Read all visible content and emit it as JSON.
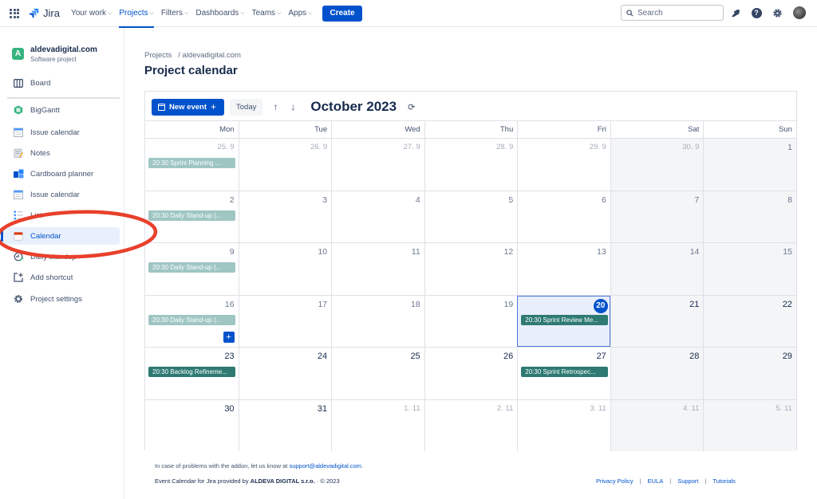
{
  "topnav": {
    "brand": "Jira",
    "items": [
      {
        "label": "Your work",
        "dropdown": true,
        "active": false
      },
      {
        "label": "Projects",
        "dropdown": true,
        "active": true
      },
      {
        "label": "Filters",
        "dropdown": true,
        "active": false
      },
      {
        "label": "Dashboards",
        "dropdown": true,
        "active": false
      },
      {
        "label": "Teams",
        "dropdown": true,
        "active": false
      },
      {
        "label": "Apps",
        "dropdown": true,
        "active": false
      }
    ],
    "create_label": "Create",
    "search_placeholder": "Search",
    "accent": "#0052cc"
  },
  "sidebar": {
    "project_initial": "A",
    "project_name": "aldevadigital.com",
    "project_type": "Software project",
    "items": [
      {
        "label": "Board",
        "icon": "board-icon"
      },
      {
        "label": "BigGantt",
        "icon": "biggantt-icon"
      },
      {
        "label": "Issue calendar",
        "icon": "issue-calendar-icon"
      },
      {
        "label": "Notes",
        "icon": "notes-icon"
      },
      {
        "label": "Cardboard planner",
        "icon": "cardboard-icon"
      },
      {
        "label": "Issue calendar",
        "icon": "issue-calendar-icon"
      },
      {
        "label": "List",
        "icon": "list-icon"
      },
      {
        "label": "Calendar",
        "icon": "calendar-icon",
        "active": true
      },
      {
        "label": "Daily standup",
        "icon": "standup-icon"
      },
      {
        "label": "Add shortcut",
        "icon": "add-shortcut-icon"
      },
      {
        "label": "Project settings",
        "icon": "gear-icon"
      }
    ]
  },
  "breadcrumb": {
    "root": "Projects",
    "sep": "/",
    "project": "aldevadigital.com"
  },
  "page_title": "Project calendar",
  "calendar": {
    "new_event_label": "New event",
    "today_label": "Today",
    "month_title": "October 2023",
    "weekdays": [
      "Mon",
      "Tue",
      "Wed",
      "Thu",
      "Fri",
      "Sat",
      "Sun"
    ],
    "weeks": [
      [
        {
          "d": "25. 9",
          "other": true
        },
        {
          "d": "26. 9",
          "other": true
        },
        {
          "d": "27. 9",
          "other": true
        },
        {
          "d": "28. 9",
          "other": true
        },
        {
          "d": "29. 9",
          "other": true
        },
        {
          "d": "30. 9",
          "other": true
        },
        {
          "d": "1"
        }
      ],
      [
        {
          "d": "2"
        },
        {
          "d": "3"
        },
        {
          "d": "4"
        },
        {
          "d": "5"
        },
        {
          "d": "6"
        },
        {
          "d": "7"
        },
        {
          "d": "8"
        }
      ],
      [
        {
          "d": "9"
        },
        {
          "d": "10"
        },
        {
          "d": "11"
        },
        {
          "d": "12"
        },
        {
          "d": "13"
        },
        {
          "d": "14"
        },
        {
          "d": "15"
        }
      ],
      [
        {
          "d": "16"
        },
        {
          "d": "17"
        },
        {
          "d": "18"
        },
        {
          "d": "19"
        },
        {
          "d": "20",
          "today": true
        },
        {
          "d": "21",
          "strong": true
        },
        {
          "d": "22",
          "strong": true
        }
      ],
      [
        {
          "d": "23",
          "strong": true
        },
        {
          "d": "24",
          "strong": true
        },
        {
          "d": "25",
          "strong": true
        },
        {
          "d": "26",
          "strong": true
        },
        {
          "d": "27",
          "strong": true
        },
        {
          "d": "28",
          "strong": true
        },
        {
          "d": "29",
          "strong": true
        }
      ],
      [
        {
          "d": "30",
          "strong": true
        },
        {
          "d": "31",
          "strong": true
        },
        {
          "d": "1. 11",
          "other": true
        },
        {
          "d": "2. 11",
          "other": true
        },
        {
          "d": "3. 11",
          "other": true
        },
        {
          "d": "4. 11",
          "other": true
        },
        {
          "d": "5. 11",
          "other": true
        }
      ]
    ],
    "events": [
      {
        "week": 0,
        "day": 0,
        "label": "20:30 Sprint Planning ...",
        "style": "faded"
      },
      {
        "week": 1,
        "day": 0,
        "label": "20:30 Daily Stand-up (...",
        "style": "faded"
      },
      {
        "week": 2,
        "day": 0,
        "label": "20:30 Daily Stand-up (...",
        "style": "faded"
      },
      {
        "week": 3,
        "day": 0,
        "label": "20:30 Daily Stand-up (...",
        "style": "faded"
      },
      {
        "week": 3,
        "day": 4,
        "label": "20:30 Sprint Review Me...",
        "style": "solid"
      },
      {
        "week": 4,
        "day": 0,
        "label": "20:30 Backlog Refineme...",
        "style": "solid"
      },
      {
        "week": 4,
        "day": 4,
        "label": "20:30 Sprint Retrospec...",
        "style": "solid"
      }
    ],
    "add_button_cell": {
      "week": 3,
      "day": 0,
      "label": "+"
    },
    "event_faded_color": "#9fc6c3",
    "event_solid_color": "#2e7a73"
  },
  "footer": {
    "problem_text": "In case of problems with the addon, let us know at",
    "email": "support@aldevadigital.com",
    "period": ".",
    "product": "Event Calendar for Jira",
    "provided_by": "provided by",
    "company": "ALDEVA DIGITAL s.r.o.",
    "copyright": "· © 2023",
    "links": [
      "Privacy Policy",
      "EULA",
      "Support",
      "Tutorials"
    ]
  },
  "annotation_color": "#e8402c"
}
